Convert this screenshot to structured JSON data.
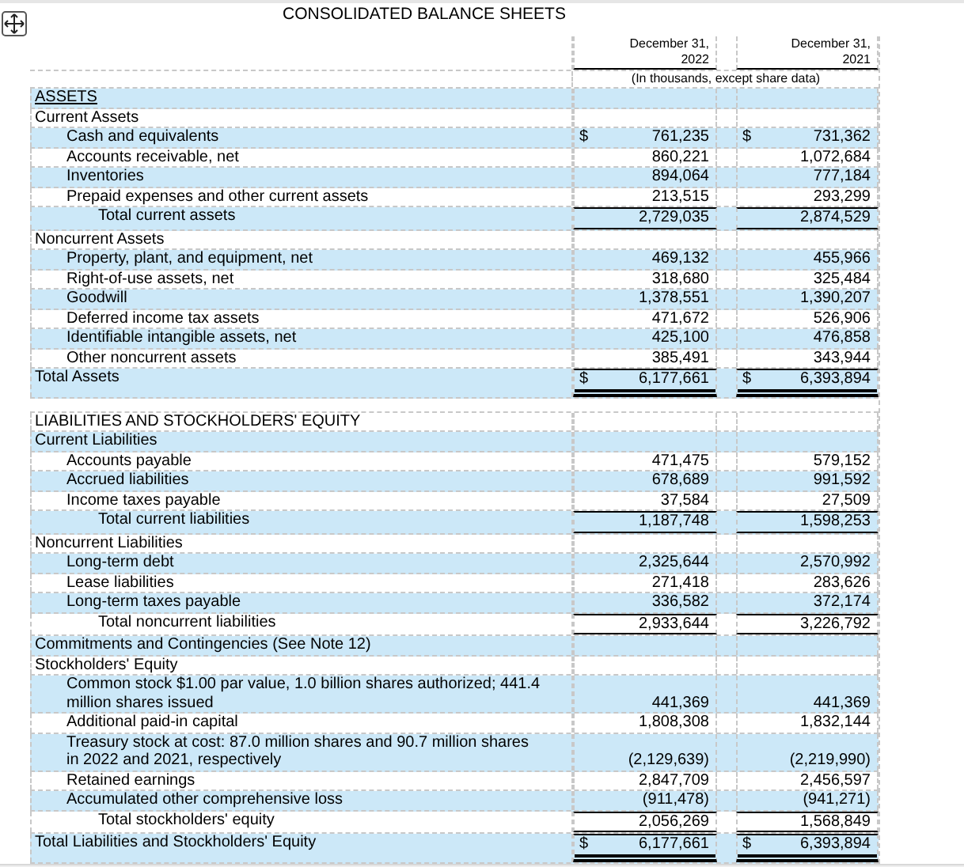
{
  "title": "CONSOLIDATED BALANCE SHEETS",
  "columns": [
    {
      "label": "December 31,",
      "year": "2022"
    },
    {
      "label": "December 31,",
      "year": "2021"
    }
  ],
  "units_note": "(In thousands, except share data)",
  "rows": [
    {
      "kind": "section",
      "label": "ASSETS",
      "underlined": true,
      "shaded": true
    },
    {
      "kind": "group",
      "label": "Current Assets",
      "shaded": false
    },
    {
      "kind": "item",
      "label": "Cash and equivalents",
      "shaded": true,
      "currency": "$",
      "values": [
        "761,235",
        "731,362"
      ]
    },
    {
      "kind": "item",
      "label": "Accounts receivable, net",
      "shaded": false,
      "values": [
        "860,221",
        "1,072,684"
      ]
    },
    {
      "kind": "item",
      "label": "Inventories",
      "shaded": true,
      "values": [
        "894,064",
        "777,184"
      ]
    },
    {
      "kind": "item",
      "label": "Prepaid expenses and other current assets",
      "shaded": false,
      "values": [
        "213,515",
        "293,299"
      ]
    },
    {
      "kind": "total",
      "label": "Total current assets",
      "shaded": true,
      "values": [
        "2,729,035",
        "2,874,529"
      ]
    },
    {
      "kind": "group",
      "label": "Noncurrent Assets",
      "shaded": false
    },
    {
      "kind": "item",
      "label": "Property, plant, and equipment, net",
      "shaded": true,
      "values": [
        "469,132",
        "455,966"
      ]
    },
    {
      "kind": "item",
      "label": "Right-of-use assets, net",
      "shaded": false,
      "values": [
        "318,680",
        "325,484"
      ]
    },
    {
      "kind": "item",
      "label": "Goodwill",
      "shaded": true,
      "values": [
        "1,378,551",
        "1,390,207"
      ]
    },
    {
      "kind": "item",
      "label": "Deferred income tax assets",
      "shaded": false,
      "values": [
        "471,672",
        "526,906"
      ]
    },
    {
      "kind": "item",
      "label": "Identifiable intangible assets, net",
      "shaded": true,
      "values": [
        "425,100",
        "476,858"
      ]
    },
    {
      "kind": "item",
      "label": "Other noncurrent assets",
      "shaded": false,
      "values": [
        "385,491",
        "343,944"
      ]
    },
    {
      "kind": "grand",
      "label": "Total Assets",
      "shaded": true,
      "currency": "$",
      "values": [
        "6,177,661",
        "6,393,894"
      ]
    },
    {
      "kind": "section",
      "label": "LIABILITIES AND STOCKHOLDERS' EQUITY",
      "underlined": false,
      "shaded": false
    },
    {
      "kind": "group",
      "label": "Current Liabilities",
      "shaded": true
    },
    {
      "kind": "item",
      "label": "Accounts payable",
      "shaded": false,
      "values": [
        "471,475",
        "579,152"
      ]
    },
    {
      "kind": "item",
      "label": "Accrued liabilities",
      "shaded": true,
      "values": [
        "678,689",
        "991,592"
      ]
    },
    {
      "kind": "item",
      "label": "Income taxes payable",
      "shaded": false,
      "values": [
        "37,584",
        "27,509"
      ]
    },
    {
      "kind": "total",
      "label": "Total current liabilities",
      "shaded": true,
      "values": [
        "1,187,748",
        "1,598,253"
      ]
    },
    {
      "kind": "group",
      "label": "Noncurrent Liabilities",
      "shaded": false
    },
    {
      "kind": "item",
      "label": "Long-term debt",
      "shaded": true,
      "values": [
        "2,325,644",
        "2,570,992"
      ]
    },
    {
      "kind": "item",
      "label": "Lease liabilities",
      "shaded": false,
      "values": [
        "271,418",
        "283,626"
      ]
    },
    {
      "kind": "item",
      "label": "Long-term taxes payable",
      "shaded": true,
      "values": [
        "336,582",
        "372,174"
      ]
    },
    {
      "kind": "total",
      "label": "Total noncurrent liabilities",
      "shaded": false,
      "values": [
        "2,933,644",
        "3,226,792"
      ]
    },
    {
      "kind": "group",
      "label": "Commitments and Contingencies (See Note 12)",
      "shaded": true
    },
    {
      "kind": "group",
      "label": "Stockholders' Equity",
      "shaded": false
    },
    {
      "kind": "item",
      "label": "Common stock $1.00 par value, 1.0 billion shares authorized; 441.4 million shares issued",
      "shaded": true,
      "values": [
        "441,369",
        "441,369"
      ]
    },
    {
      "kind": "item",
      "label": "Additional paid-in capital",
      "shaded": false,
      "values": [
        "1,808,308",
        "1,832,144"
      ]
    },
    {
      "kind": "item",
      "label": "Treasury stock at cost: 87.0 million shares and 90.7 million shares in 2022 and 2021, respectively",
      "shaded": true,
      "values": [
        "(2,129,639)",
        "(2,219,990)"
      ]
    },
    {
      "kind": "item",
      "label": "Retained earnings",
      "shaded": false,
      "values": [
        "2,847,709",
        "2,456,597"
      ]
    },
    {
      "kind": "item",
      "label": "Accumulated other comprehensive loss",
      "shaded": true,
      "values": [
        "(911,478)",
        "(941,271)"
      ]
    },
    {
      "kind": "total",
      "label": "Total stockholders' equity",
      "shaded": false,
      "values": [
        "2,056,269",
        "1,568,849"
      ]
    },
    {
      "kind": "grand",
      "label": "Total Liabilities and Stockholders' Equity",
      "shaded": true,
      "currency": "$",
      "values": [
        "6,177,661",
        "6,393,894"
      ]
    }
  ]
}
